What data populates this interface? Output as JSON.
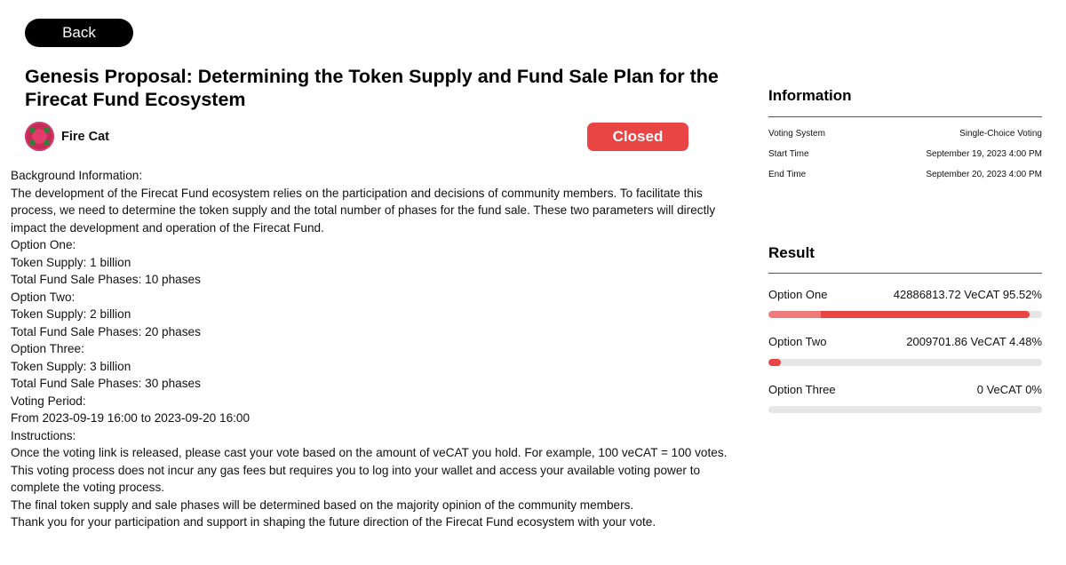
{
  "header": {
    "back_label": "Back"
  },
  "proposal": {
    "title": "Genesis Proposal: Determining the Token Supply and Fund Sale Plan for the Firecat Fund Ecosystem",
    "author": "Fire Cat",
    "status": "Closed",
    "avatar_icon": "fire-cat-avatar"
  },
  "content": {
    "lines": [
      "Background Information:",
      "The development of the Firecat Fund ecosystem relies on the participation and decisions of community members. To facilitate this",
      "process, we need to determine the token supply and the total number of phases for the fund sale. These two parameters will directly",
      "impact the development and operation of the Firecat Fund.",
      "Option One:",
      "Token Supply: 1 billion",
      "Total Fund Sale Phases: 10 phases",
      "Option Two:",
      "Token Supply: 2 billion",
      "Total Fund Sale Phases: 20 phases",
      "Option Three:",
      "Token Supply: 3 billion",
      "Total Fund Sale Phases: 30 phases",
      "Voting Period:",
      "From 2023-09-19 16:00 to 2023-09-20 16:00",
      "Instructions:",
      "Once the voting link is released, please cast your vote based on the amount of veCAT you hold. For example, 100 veCAT = 100 votes.",
      "This voting process does not incur any gas fees but requires you to log into your wallet and access your available voting power to",
      "complete the voting process.",
      "The final token supply and sale phases will be determined based on the majority opinion of the community members.",
      "Thank you for your participation and support in shaping the future direction of the Firecat Fund ecosystem with your vote."
    ]
  },
  "information": {
    "title": "Information",
    "rows": [
      {
        "label": "Voting System",
        "value": "Single-Choice Voting"
      },
      {
        "label": "Start Time",
        "value": "September 19, 2023 4:00 PM"
      },
      {
        "label": "End Time",
        "value": "September 20, 2023 4:00 PM"
      }
    ]
  },
  "result": {
    "title": "Result",
    "options": [
      {
        "label": "Option One",
        "value": "42886813.72 VeCAT 95.52%",
        "percent": 95.52
      },
      {
        "label": "Option Two",
        "value": "2009701.86 VeCAT 4.48%",
        "percent": 4.48
      },
      {
        "label": "Option Three",
        "value": "0 VeCAT 0%",
        "percent": 0
      }
    ]
  },
  "colors": {
    "accent": "#e94545",
    "accent_light": "#f07b7b",
    "track": "#e6e6e6",
    "button_dark": "#000000"
  }
}
